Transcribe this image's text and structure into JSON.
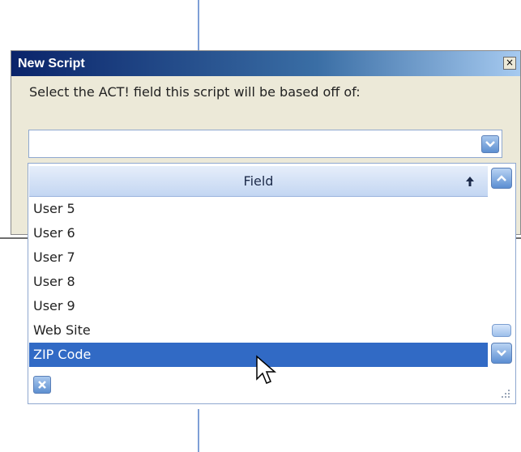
{
  "dialog": {
    "title": "New Script",
    "close_glyph": "×",
    "prompt": "Select the ACT! field this script will be based off of:",
    "combo_value": ""
  },
  "dropdown": {
    "column_header": "Field",
    "sort_direction": "ascending",
    "items": [
      "User 5",
      "User 6",
      "User 7",
      "User 8",
      "User 9",
      "Web Site",
      "ZIP Code"
    ],
    "selected_item": "ZIP Code"
  },
  "icons": {
    "combo_arrow": "chevron-down-icon",
    "sort": "arrow-up-icon",
    "scroll_up": "chevron-up-icon",
    "scroll_down": "chevron-down-icon",
    "footer": "close-icon",
    "resize": "resize-grip-icon",
    "cursor": "mouse-pointer-icon"
  },
  "colors": {
    "selection": "#316ac5",
    "title_bar": "#0a246a",
    "accent_blue": "#5d8fd0"
  }
}
